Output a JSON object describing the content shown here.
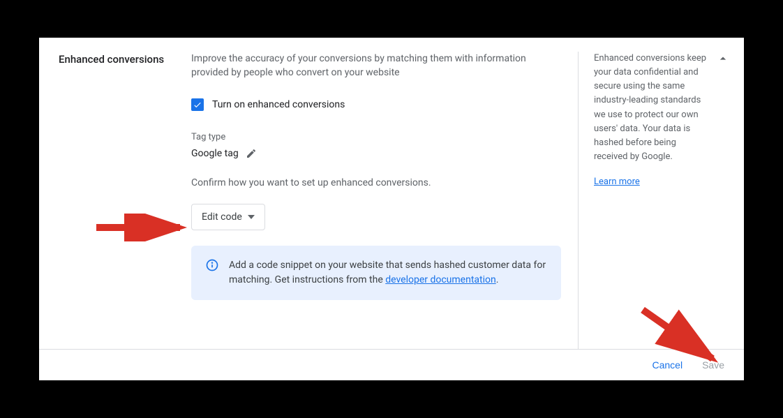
{
  "section": {
    "title": "Enhanced conversions",
    "description": "Improve the accuracy of your conversions by matching them with information provided by people who convert on your website",
    "checkbox_label": "Turn on enhanced conversions",
    "checkbox_checked": true,
    "tag_type_label": "Tag type",
    "tag_type_value": "Google tag",
    "confirm_prompt": "Confirm how you want to set up enhanced conversions.",
    "dropdown_value": "Edit code",
    "info_text_1": "Add a code snippet on your website that sends hashed customer data for matching. Get instructions from the ",
    "info_link": "developer documentation",
    "info_period": "."
  },
  "side": {
    "note": "Enhanced conversions keep your data confidential and secure using the same industry-leading standards we use to protect our own users' data. Your data is hashed before being received by Google.",
    "learn_more": "Learn more"
  },
  "footer": {
    "cancel": "Cancel",
    "save": "Save"
  }
}
